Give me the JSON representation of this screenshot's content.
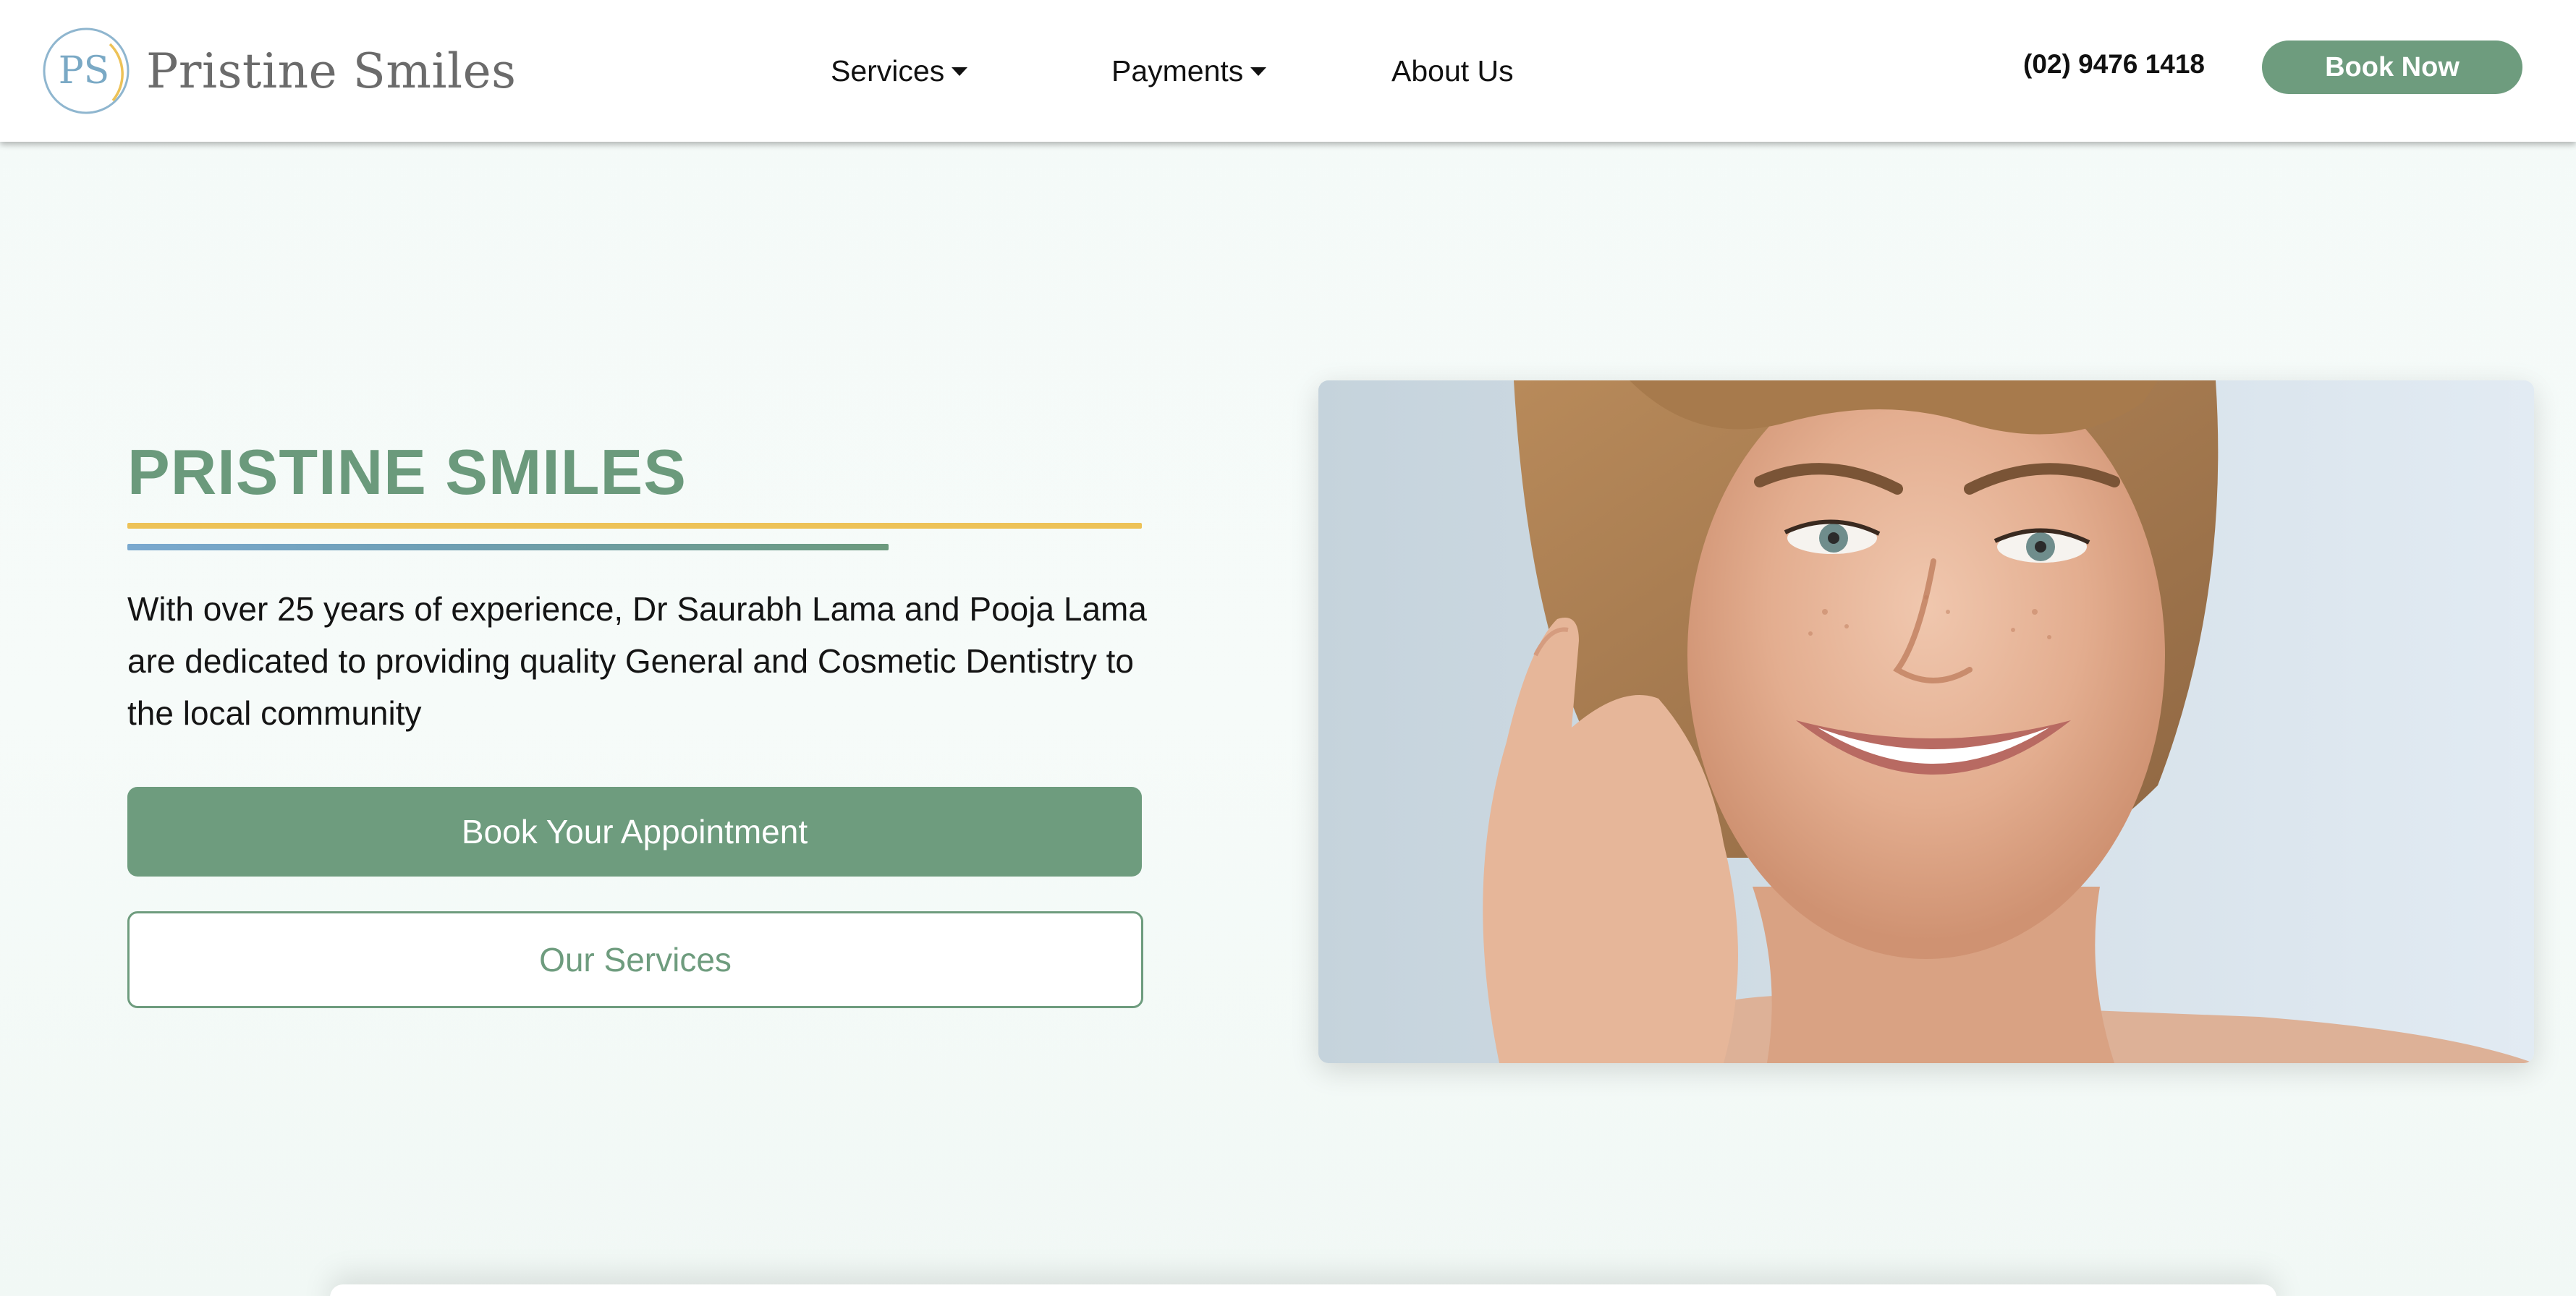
{
  "header": {
    "brand_name": "Pristine Smiles",
    "logo_monogram": "PS",
    "nav": [
      {
        "label": "Services",
        "has_dropdown": true
      },
      {
        "label": "Payments",
        "has_dropdown": true
      },
      {
        "label": "About Us",
        "has_dropdown": false
      }
    ],
    "phone": "(02) 9476 1418",
    "book_now_label": "Book Now"
  },
  "hero": {
    "title": "PRISTINE SMILES",
    "description": "With over 25 years of experience, Dr Saurabh Lama and Pooja Lama are dedicated to providing quality General and Cosmetic Dentistry to the local community",
    "primary_button": "Book Your Appointment",
    "secondary_button": "Our Services"
  },
  "colors": {
    "brand_green": "#6e9c7e",
    "accent_gold": "#edc257",
    "accent_blue": "#7aa9cf",
    "page_background": "#f4faf8"
  },
  "icons": {
    "logo": "ps-monogram-logo",
    "dropdown": "caret-down-icon"
  }
}
